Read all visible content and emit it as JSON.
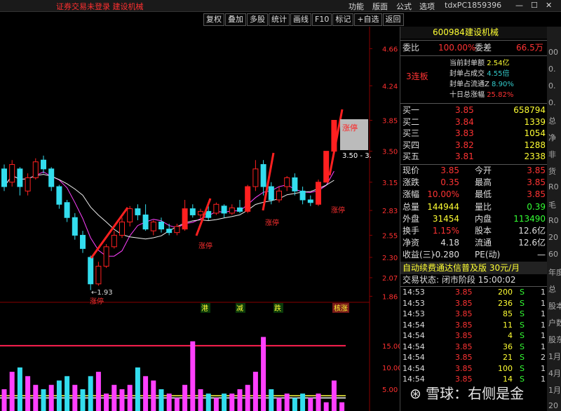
{
  "topbar": {
    "warning": "证券交易未登录  建设机械",
    "menu": [
      "功能",
      "版面",
      "公式",
      "选项"
    ],
    "user": "tdxPC1859396"
  },
  "toolbar": [
    "复权",
    "叠加",
    "多股",
    "统计",
    "画线",
    "F10",
    "标记",
    "+自选",
    "返回"
  ],
  "chart": {
    "y_ticks": [
      "4.66",
      "4.24",
      "3.85",
      "3.50",
      "3.15",
      "2.83",
      "2.55",
      "2.30",
      "2.07",
      "1.86"
    ],
    "low_label": "←1.93",
    "limit_up": "涨停",
    "limit_up_box": "涨停",
    "price_range": "3.50 - 3.",
    "signal_tags": [
      "港",
      "减",
      "跌",
      "核涨"
    ],
    "vol_ticks": [
      "15.00",
      "10.00",
      "5.00"
    ],
    "candles": [
      {
        "o": 3.3,
        "c": 3.1,
        "h": 3.35,
        "l": 3.05
      },
      {
        "o": 3.15,
        "c": 3.35,
        "h": 3.4,
        "l": 3.1
      },
      {
        "o": 3.3,
        "c": 3.1,
        "h": 3.32,
        "l": 3.0
      },
      {
        "o": 3.05,
        "c": 3.2,
        "h": 3.25,
        "l": 3.0
      },
      {
        "o": 3.2,
        "c": 3.38,
        "h": 3.42,
        "l": 3.18
      },
      {
        "o": 3.4,
        "c": 3.3,
        "h": 3.45,
        "l": 3.25
      },
      {
        "o": 3.3,
        "c": 3.1,
        "h": 3.32,
        "l": 3.05
      },
      {
        "o": 3.1,
        "c": 2.9,
        "h": 3.12,
        "l": 2.85
      },
      {
        "o": 2.92,
        "c": 2.75,
        "h": 2.95,
        "l": 2.7
      },
      {
        "o": 2.75,
        "c": 2.55,
        "h": 2.8,
        "l": 2.5
      },
      {
        "o": 2.55,
        "c": 2.4,
        "h": 2.6,
        "l": 2.35
      },
      {
        "o": 2.3,
        "c": 2.0,
        "h": 2.32,
        "l": 1.93
      },
      {
        "o": 2.0,
        "c": 2.2,
        "h": 2.25,
        "l": 1.98
      },
      {
        "o": 2.2,
        "c": 2.42,
        "h": 2.45,
        "l": 2.18
      },
      {
        "o": 2.42,
        "c": 2.55,
        "h": 2.6,
        "l": 2.4
      },
      {
        "o": 2.55,
        "c": 2.7,
        "h": 2.75,
        "l": 2.52
      },
      {
        "o": 2.7,
        "c": 2.85,
        "h": 2.88,
        "l": 2.65
      },
      {
        "o": 2.85,
        "c": 2.78,
        "h": 2.9,
        "l": 2.72
      },
      {
        "o": 2.78,
        "c": 2.62,
        "h": 2.9,
        "l": 2.6
      },
      {
        "o": 2.6,
        "c": 2.7,
        "h": 2.72,
        "l": 2.55
      },
      {
        "o": 2.7,
        "c": 2.62,
        "h": 2.75,
        "l": 2.58
      },
      {
        "o": 2.62,
        "c": 2.58,
        "h": 2.68,
        "l": 2.55
      },
      {
        "o": 2.58,
        "c": 2.65,
        "h": 2.68,
        "l": 2.55
      },
      {
        "o": 2.62,
        "c": 2.85,
        "h": 2.95,
        "l": 2.6
      },
      {
        "o": 2.85,
        "c": 2.78,
        "h": 2.9,
        "l": 2.75
      },
      {
        "o": 2.78,
        "c": 2.82,
        "h": 2.85,
        "l": 2.72
      },
      {
        "o": 2.82,
        "c": 2.75,
        "h": 2.88,
        "l": 2.72
      },
      {
        "o": 2.8,
        "c": 2.9,
        "h": 2.92,
        "l": 2.78
      },
      {
        "o": 2.88,
        "c": 2.8,
        "h": 2.9,
        "l": 2.75
      },
      {
        "o": 2.8,
        "c": 2.86,
        "h": 2.9,
        "l": 2.78
      },
      {
        "o": 2.86,
        "c": 2.82,
        "h": 2.95,
        "l": 2.8
      },
      {
        "o": 2.82,
        "c": 3.1,
        "h": 3.12,
        "l": 2.8
      },
      {
        "o": 3.1,
        "c": 3.3,
        "h": 3.4,
        "l": 3.05
      },
      {
        "o": 3.35,
        "c": 3.1,
        "h": 3.4,
        "l": 3.0
      },
      {
        "o": 3.1,
        "c": 2.95,
        "h": 3.15,
        "l": 2.9
      },
      {
        "o": 2.95,
        "c": 3.05,
        "h": 3.1,
        "l": 2.92
      },
      {
        "o": 3.1,
        "c": 3.2,
        "h": 3.22,
        "l": 3.05
      },
      {
        "o": 3.2,
        "c": 3.05,
        "h": 3.25,
        "l": 3.0
      },
      {
        "o": 3.05,
        "c": 2.95,
        "h": 3.1,
        "l": 2.9
      },
      {
        "o": 2.95,
        "c": 2.92,
        "h": 3.0,
        "l": 2.88
      },
      {
        "o": 2.9,
        "c": 3.15,
        "h": 3.18,
        "l": 2.88
      },
      {
        "o": 3.15,
        "c": 3.5,
        "h": 3.5,
        "l": 3.15
      },
      {
        "o": 3.5,
        "c": 3.85,
        "h": 3.85,
        "l": 3.5
      }
    ],
    "volumes": [
      5,
      9,
      10,
      8,
      6,
      5,
      6,
      7,
      8,
      6,
      5,
      8,
      9,
      4,
      6,
      5,
      6,
      10,
      8,
      7,
      5,
      4,
      3,
      6,
      16,
      5,
      4,
      3,
      4,
      4,
      5,
      6,
      9,
      17,
      5,
      3,
      4,
      3,
      4,
      3,
      4,
      2,
      7,
      2
    ]
  },
  "quote": {
    "code": "600984",
    "name": "建设机械",
    "wb_label": "委比",
    "wb_val": "100.00%",
    "wc_label": "委差",
    "wc_val": "66.5万",
    "lianban": "3连板",
    "seal": [
      [
        "当前封单额",
        "2.54亿"
      ],
      [
        "封单占成交",
        "4.55倍"
      ],
      [
        "封单占流通Z",
        "8.90%"
      ],
      [
        "十日总涨幅",
        "25.82%"
      ]
    ],
    "buys": [
      [
        "买一",
        "3.85",
        "658794"
      ],
      [
        "买二",
        "3.84",
        "1339"
      ],
      [
        "买三",
        "3.83",
        "1054"
      ],
      [
        "买四",
        "3.82",
        "1288"
      ],
      [
        "买五",
        "3.81",
        "2338"
      ]
    ],
    "stats": [
      [
        "现价",
        "3.85",
        "今开",
        "3.85"
      ],
      [
        "涨跌",
        "0.35",
        "最高",
        "3.85"
      ],
      [
        "涨幅",
        "10.00%",
        "最低",
        "3.85"
      ],
      [
        "总量",
        "144944",
        "量比",
        "0.39"
      ],
      [
        "外盘",
        "31454",
        "内盘",
        "113490"
      ],
      [
        "换手",
        "1.15%",
        "股本",
        "12.6亿"
      ],
      [
        "净资",
        "4.18",
        "流通",
        "12.6亿"
      ],
      [
        "收益(三)",
        "-0.280",
        "PE(动)",
        "—"
      ]
    ],
    "banner": "自动续费通达信普及版  30元/月",
    "status": "交易状态: 闭市阶段 15:00:02",
    "trades": [
      [
        "14:53",
        "3.85",
        "200",
        "S",
        "1"
      ],
      [
        "14:53",
        "3.85",
        "236",
        "S",
        "1"
      ],
      [
        "14:53",
        "3.85",
        "85",
        "S",
        "1"
      ],
      [
        "14:54",
        "3.85",
        "11",
        "S",
        "1"
      ],
      [
        "14:54",
        "3.85",
        "4",
        "S",
        "1"
      ],
      [
        "14:54",
        "3.85",
        "36",
        "S",
        "1"
      ],
      [
        "14:54",
        "3.85",
        "21",
        "S",
        "2"
      ],
      [
        "14:54",
        "3.85",
        "100",
        "S",
        "1"
      ],
      [
        "14:54",
        "3.85",
        "14",
        "S",
        "1"
      ]
    ]
  },
  "rightstrip": [
    "00",
    "0.",
    "0.",
    "0.",
    "总",
    "净",
    "非",
    "货",
    "R0",
    "毛",
    "R0",
    "20",
    "60",
    "年度",
    "总",
    "股本",
    "户数",
    "股东",
    "1月",
    "4月",
    "1月",
    "20"
  ],
  "watermark": "⊛ 雪球：右侧是金"
}
